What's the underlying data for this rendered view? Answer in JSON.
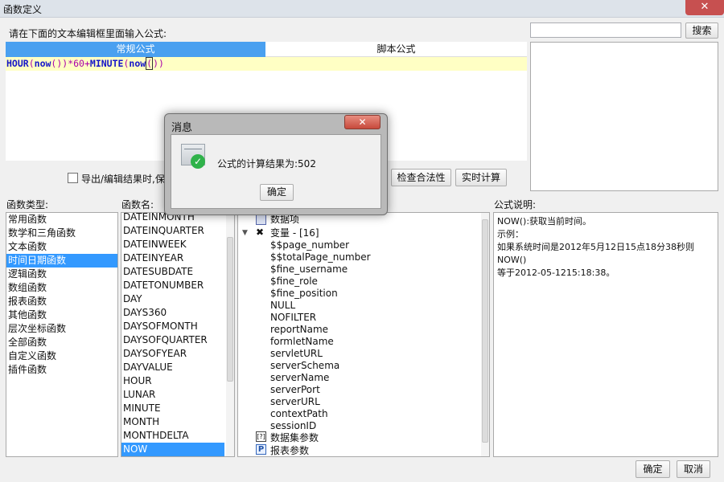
{
  "window": {
    "title": "函数定义",
    "close_glyph": "✕"
  },
  "editor": {
    "prompt_label": "请在下面的文本编辑框里面输入公式:",
    "tabs": [
      "常规公式",
      "脚本公式"
    ],
    "formula": {
      "p1": "HOUR",
      "p2": "(",
      "p3": "now",
      "p4": "())",
      "p5": "*60+",
      "p6": "MINUTE",
      "p7": "(",
      "p8": "now",
      "p9": "(",
      "p10": ")",
      "p11": ")"
    },
    "checkbox_label": "导出/编辑结果时,保留",
    "validate_button": "检查合法性",
    "compute_button": "实时计算"
  },
  "search": {
    "value": "",
    "button": "搜索"
  },
  "function_types": {
    "label": "函数类型:",
    "items": [
      "常用函数",
      "数学和三角函数",
      "文本函数",
      "时间日期函数",
      "逻辑函数",
      "数组函数",
      "报表函数",
      "其他函数",
      "层次坐标函数",
      "全部函数",
      "自定义函数",
      "插件函数"
    ],
    "selected": "时间日期函数"
  },
  "function_names": {
    "label": "函数名:",
    "items": [
      "DATEINMONTH",
      "DATEINQUARTER",
      "DATEINWEEK",
      "DATEINYEAR",
      "DATESUBDATE",
      "DATETONUMBER",
      "DAY",
      "DAYS360",
      "DAYSOFMONTH",
      "DAYSOFQUARTER",
      "DAYSOFYEAR",
      "DAYVALUE",
      "HOUR",
      "LUNAR",
      "MINUTE",
      "MONTH",
      "MONTHDELTA",
      "NOW"
    ],
    "selected": "NOW"
  },
  "tree": {
    "data_item": "数据项",
    "variables": "变量 - [16]",
    "vars": [
      "$$page_number",
      "$$totalPage_number",
      "$fine_username",
      "$fine_role",
      "$fine_position",
      "NULL",
      "NOFILTER",
      "reportName",
      "formletName",
      "servletURL",
      "serverSchema",
      "serverName",
      "serverPort",
      "serverURL",
      "contextPath",
      "sessionID"
    ],
    "dataset_params": "数据集参数",
    "report_params": "报表参数"
  },
  "description": {
    "label": "公式说明:",
    "line1": "NOW():获取当前时间。",
    "line2": "示例：",
    "line3": "如果系统时间是2012年5月12日15点18分38秒则NOW()",
    "line4": "等于2012-05-1215:18:38。"
  },
  "footer": {
    "ok": "确定",
    "cancel": "取消"
  },
  "modal": {
    "title": "消息",
    "message": "公式的计算结果为:502",
    "ok": "确定"
  },
  "colors": {
    "accent": "#3399ff",
    "tab_active": "#4aa0f0",
    "formula_bg": "#ffffc4",
    "success": "#2fb24a"
  }
}
